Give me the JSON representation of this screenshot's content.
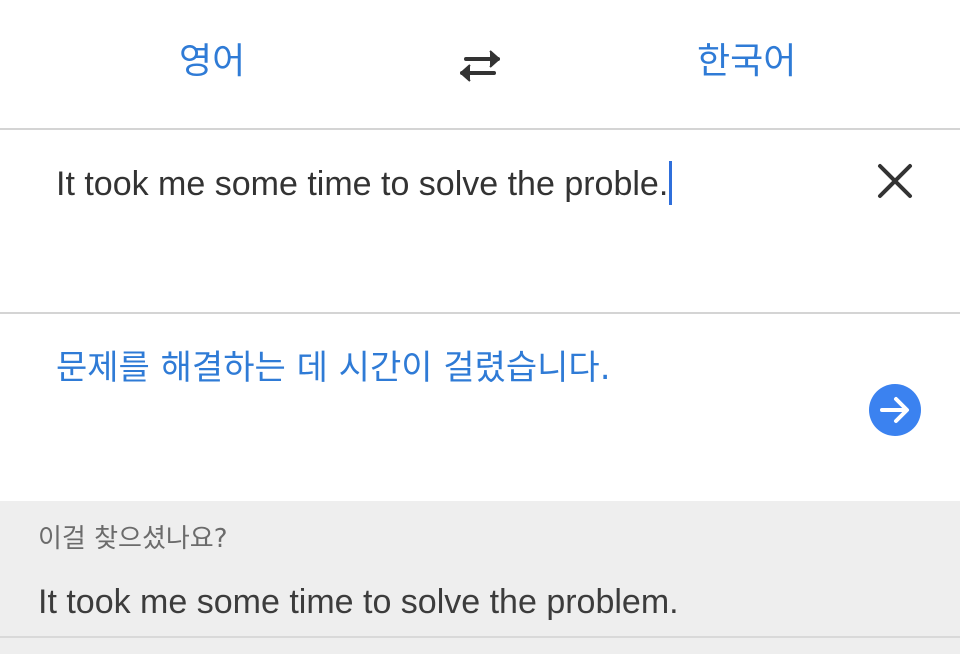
{
  "languages": {
    "source": "영어",
    "target": "한국어"
  },
  "icons": {
    "swap": "swap-arrows-icon",
    "clear": "close-icon",
    "submit": "arrow-right-icon"
  },
  "input": {
    "text": "It took me some time to solve the proble."
  },
  "translation": {
    "text": "문제를 해결하는 데 시간이 걸렸습니다."
  },
  "suggestion": {
    "label": "이걸 찾으셨나요?",
    "text": "It took me some time to solve the problem."
  },
  "colors": {
    "accent": "#2f7bd6",
    "button": "#3b82f0",
    "suggestion_bg": "#eeeeee"
  }
}
